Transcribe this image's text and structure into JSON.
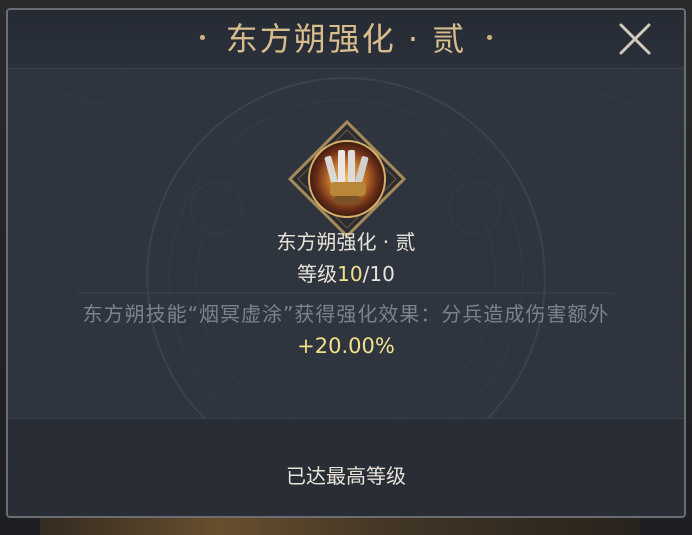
{
  "dialog": {
    "title": "东方朔强化 · 贰",
    "close_icon": "close-icon"
  },
  "skill": {
    "icon": "skill-gauntlet-icon",
    "name": "东方朔强化 · 贰",
    "level_prefix": "等级",
    "level_current": "10",
    "level_separator": "/",
    "level_max": "10",
    "description": "东方朔技能“烟冥虚涂”获得强化效果：分兵造成伤害额外",
    "bonus": "+20.00%"
  },
  "footer": {
    "status": "已达最高等级"
  },
  "colors": {
    "title": "#d8bd8c",
    "highlight": "#f0e08a",
    "muted_text": "#7b828d",
    "panel": "#2f353f"
  }
}
